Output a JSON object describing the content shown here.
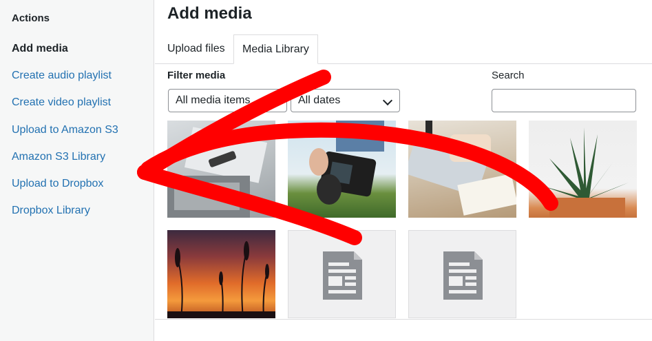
{
  "sidebar": {
    "heading": "Actions",
    "items": [
      {
        "label": "Add media"
      },
      {
        "label": "Create audio playlist"
      },
      {
        "label": "Create video playlist"
      },
      {
        "label": "Upload to Amazon S3"
      },
      {
        "label": "Amazon S3 Library"
      },
      {
        "label": "Upload to Dropbox"
      },
      {
        "label": "Dropbox Library"
      }
    ]
  },
  "main": {
    "title": "Add media",
    "tabs": [
      "Upload files",
      "Media Library"
    ],
    "filter_label": "Filter media",
    "filter_type_value": "All media items",
    "filter_date_value": "All dates",
    "search_label": "Search",
    "search_value": ""
  },
  "media_grid": [
    {
      "kind": "photo",
      "subject": "desk-with-notebook"
    },
    {
      "kind": "photo",
      "subject": "hand-holding-camera"
    },
    {
      "kind": "photo",
      "subject": "typing-on-laptop"
    },
    {
      "kind": "photo",
      "subject": "potted-succulent"
    },
    {
      "kind": "photo",
      "subject": "grass-at-sunset"
    },
    {
      "kind": "document",
      "subject": "document-icon"
    },
    {
      "kind": "document",
      "subject": "document-icon"
    }
  ],
  "annotation": {
    "color": "#ff0000"
  }
}
